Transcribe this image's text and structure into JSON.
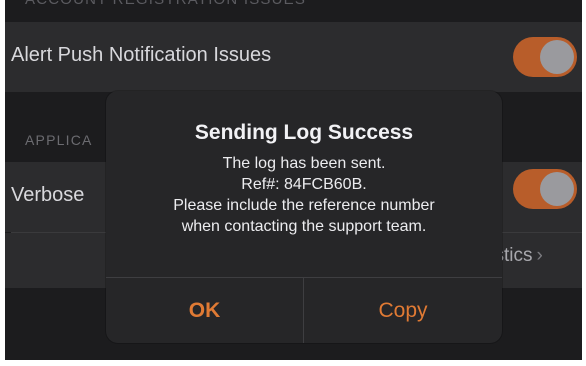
{
  "settings": {
    "section_top_header": "ACCOUNT REGISTRATION ISSUES",
    "alert_push_row": {
      "label": "Alert Push Notification Issues",
      "toggle_on": true
    },
    "application_header": "APPLICA",
    "verbose_row": {
      "label": "Verbose",
      "toggle_on": true
    },
    "statistics_row": {
      "label": "tistics"
    }
  },
  "dialog": {
    "title": "Sending Log Success",
    "message_lines": [
      "The log has been sent.",
      "Ref#: 84FCB60B.",
      "Please include the reference number",
      "when contacting the support team."
    ],
    "buttons": {
      "ok": "OK",
      "copy": "Copy"
    }
  },
  "colors": {
    "accent": "#e07a34",
    "toggle_on": "#b85d2a",
    "background": "#1c1c1e",
    "row_background": "#2c2c2e",
    "dialog_background": "#262628"
  },
  "icons": {
    "chevron": "chevron-right-icon"
  }
}
